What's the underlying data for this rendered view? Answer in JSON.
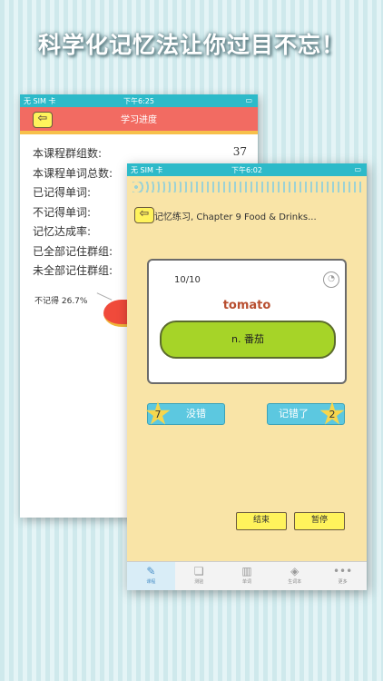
{
  "headline": "科学化记忆法让你过目不忘！",
  "back": {
    "status": {
      "carrier": "无 SIM 卡",
      "time": "下午6:25"
    },
    "nav_title": "学习进度",
    "stats": [
      {
        "label": "本课程群组数:",
        "value": "37"
      },
      {
        "label": "本课程单词总数:",
        "value": ""
      },
      {
        "label": "已记得单词:",
        "value": ""
      },
      {
        "label": "不记得单词:",
        "value": ""
      },
      {
        "label": "记忆达成率:",
        "value": ""
      },
      {
        "label": "已全部记住群组:",
        "value": ""
      },
      {
        "label": "未全部记住群组:",
        "value": ""
      }
    ],
    "pie_label": "不记得 26.7%"
  },
  "front": {
    "status": {
      "carrier": "无 SIM 卡",
      "time": "下午6:02"
    },
    "title": "记忆练习, Chapter 9 Food & Drinks...",
    "count": "10/10",
    "word": "tomato",
    "meaning": "n. 番茄",
    "wrong_count": "7",
    "wrong_label": "没错",
    "remember_label": "记错了",
    "remember_count": "2",
    "end_label": "结束",
    "pause_label": "暂停",
    "tabs": [
      {
        "label": "课程",
        "icon": "pencil-icon",
        "active": true
      },
      {
        "label": "测验",
        "icon": "quiz-icon",
        "active": false
      },
      {
        "label": "单词",
        "icon": "book-icon",
        "active": false
      },
      {
        "label": "生词本",
        "icon": "tag-icon",
        "active": false
      },
      {
        "label": "更多",
        "icon": "more-icon",
        "active": false
      }
    ]
  },
  "colors": {
    "status": "#2dbac9",
    "nav": "#f26b62",
    "accent": "#f7c04a",
    "bone": "#a6d428",
    "button": "#5cc8e0",
    "word": "#b84e2f"
  }
}
